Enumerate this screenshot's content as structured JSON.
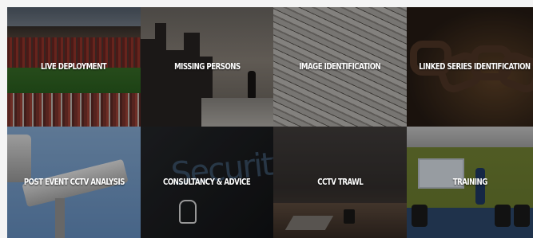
{
  "tiles": [
    {
      "label": "LIVE DEPLOYMENT"
    },
    {
      "label": "MISSING PERSONS"
    },
    {
      "label": "IMAGE IDENTIFICATION"
    },
    {
      "label": "LINKED SERIES IDENTIFICATION"
    },
    {
      "label": "POST EVENT CCTV ANALYSIS"
    },
    {
      "label": "CONSULTANCY & ADVICE"
    },
    {
      "label": "CCTV TRAWL"
    },
    {
      "label": "TRAINING"
    }
  ],
  "security_word": "Security",
  "colors": {
    "label_text": "#ffffff",
    "overlay": "#000000"
  }
}
